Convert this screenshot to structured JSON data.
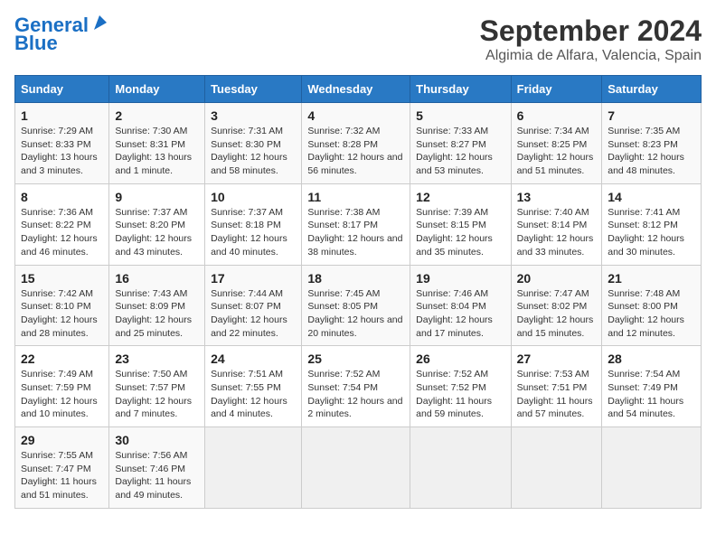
{
  "logo": {
    "line1": "General",
    "line2": "Blue"
  },
  "title": "September 2024",
  "subtitle": "Algimia de Alfara, Valencia, Spain",
  "days_of_week": [
    "Sunday",
    "Monday",
    "Tuesday",
    "Wednesday",
    "Thursday",
    "Friday",
    "Saturday"
  ],
  "weeks": [
    [
      {
        "day": 1,
        "sunrise": "Sunrise: 7:29 AM",
        "sunset": "Sunset: 8:33 PM",
        "daylight": "Daylight: 13 hours and 3 minutes."
      },
      {
        "day": 2,
        "sunrise": "Sunrise: 7:30 AM",
        "sunset": "Sunset: 8:31 PM",
        "daylight": "Daylight: 13 hours and 1 minute."
      },
      {
        "day": 3,
        "sunrise": "Sunrise: 7:31 AM",
        "sunset": "Sunset: 8:30 PM",
        "daylight": "Daylight: 12 hours and 58 minutes."
      },
      {
        "day": 4,
        "sunrise": "Sunrise: 7:32 AM",
        "sunset": "Sunset: 8:28 PM",
        "daylight": "Daylight: 12 hours and 56 minutes."
      },
      {
        "day": 5,
        "sunrise": "Sunrise: 7:33 AM",
        "sunset": "Sunset: 8:27 PM",
        "daylight": "Daylight: 12 hours and 53 minutes."
      },
      {
        "day": 6,
        "sunrise": "Sunrise: 7:34 AM",
        "sunset": "Sunset: 8:25 PM",
        "daylight": "Daylight: 12 hours and 51 minutes."
      },
      {
        "day": 7,
        "sunrise": "Sunrise: 7:35 AM",
        "sunset": "Sunset: 8:23 PM",
        "daylight": "Daylight: 12 hours and 48 minutes."
      }
    ],
    [
      {
        "day": 8,
        "sunrise": "Sunrise: 7:36 AM",
        "sunset": "Sunset: 8:22 PM",
        "daylight": "Daylight: 12 hours and 46 minutes."
      },
      {
        "day": 9,
        "sunrise": "Sunrise: 7:37 AM",
        "sunset": "Sunset: 8:20 PM",
        "daylight": "Daylight: 12 hours and 43 minutes."
      },
      {
        "day": 10,
        "sunrise": "Sunrise: 7:37 AM",
        "sunset": "Sunset: 8:18 PM",
        "daylight": "Daylight: 12 hours and 40 minutes."
      },
      {
        "day": 11,
        "sunrise": "Sunrise: 7:38 AM",
        "sunset": "Sunset: 8:17 PM",
        "daylight": "Daylight: 12 hours and 38 minutes."
      },
      {
        "day": 12,
        "sunrise": "Sunrise: 7:39 AM",
        "sunset": "Sunset: 8:15 PM",
        "daylight": "Daylight: 12 hours and 35 minutes."
      },
      {
        "day": 13,
        "sunrise": "Sunrise: 7:40 AM",
        "sunset": "Sunset: 8:14 PM",
        "daylight": "Daylight: 12 hours and 33 minutes."
      },
      {
        "day": 14,
        "sunrise": "Sunrise: 7:41 AM",
        "sunset": "Sunset: 8:12 PM",
        "daylight": "Daylight: 12 hours and 30 minutes."
      }
    ],
    [
      {
        "day": 15,
        "sunrise": "Sunrise: 7:42 AM",
        "sunset": "Sunset: 8:10 PM",
        "daylight": "Daylight: 12 hours and 28 minutes."
      },
      {
        "day": 16,
        "sunrise": "Sunrise: 7:43 AM",
        "sunset": "Sunset: 8:09 PM",
        "daylight": "Daylight: 12 hours and 25 minutes."
      },
      {
        "day": 17,
        "sunrise": "Sunrise: 7:44 AM",
        "sunset": "Sunset: 8:07 PM",
        "daylight": "Daylight: 12 hours and 22 minutes."
      },
      {
        "day": 18,
        "sunrise": "Sunrise: 7:45 AM",
        "sunset": "Sunset: 8:05 PM",
        "daylight": "Daylight: 12 hours and 20 minutes."
      },
      {
        "day": 19,
        "sunrise": "Sunrise: 7:46 AM",
        "sunset": "Sunset: 8:04 PM",
        "daylight": "Daylight: 12 hours and 17 minutes."
      },
      {
        "day": 20,
        "sunrise": "Sunrise: 7:47 AM",
        "sunset": "Sunset: 8:02 PM",
        "daylight": "Daylight: 12 hours and 15 minutes."
      },
      {
        "day": 21,
        "sunrise": "Sunrise: 7:48 AM",
        "sunset": "Sunset: 8:00 PM",
        "daylight": "Daylight: 12 hours and 12 minutes."
      }
    ],
    [
      {
        "day": 22,
        "sunrise": "Sunrise: 7:49 AM",
        "sunset": "Sunset: 7:59 PM",
        "daylight": "Daylight: 12 hours and 10 minutes."
      },
      {
        "day": 23,
        "sunrise": "Sunrise: 7:50 AM",
        "sunset": "Sunset: 7:57 PM",
        "daylight": "Daylight: 12 hours and 7 minutes."
      },
      {
        "day": 24,
        "sunrise": "Sunrise: 7:51 AM",
        "sunset": "Sunset: 7:55 PM",
        "daylight": "Daylight: 12 hours and 4 minutes."
      },
      {
        "day": 25,
        "sunrise": "Sunrise: 7:52 AM",
        "sunset": "Sunset: 7:54 PM",
        "daylight": "Daylight: 12 hours and 2 minutes."
      },
      {
        "day": 26,
        "sunrise": "Sunrise: 7:52 AM",
        "sunset": "Sunset: 7:52 PM",
        "daylight": "Daylight: 11 hours and 59 minutes."
      },
      {
        "day": 27,
        "sunrise": "Sunrise: 7:53 AM",
        "sunset": "Sunset: 7:51 PM",
        "daylight": "Daylight: 11 hours and 57 minutes."
      },
      {
        "day": 28,
        "sunrise": "Sunrise: 7:54 AM",
        "sunset": "Sunset: 7:49 PM",
        "daylight": "Daylight: 11 hours and 54 minutes."
      }
    ],
    [
      {
        "day": 29,
        "sunrise": "Sunrise: 7:55 AM",
        "sunset": "Sunset: 7:47 PM",
        "daylight": "Daylight: 11 hours and 51 minutes."
      },
      {
        "day": 30,
        "sunrise": "Sunrise: 7:56 AM",
        "sunset": "Sunset: 7:46 PM",
        "daylight": "Daylight: 11 hours and 49 minutes."
      },
      null,
      null,
      null,
      null,
      null
    ]
  ]
}
